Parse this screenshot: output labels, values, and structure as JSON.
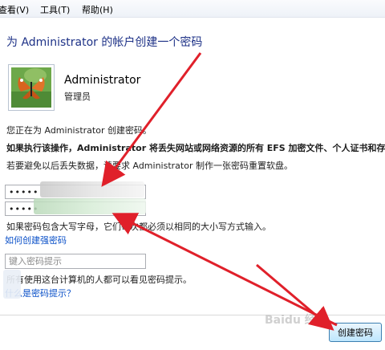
{
  "menu": {
    "view": "查看(V)",
    "tools": "工具(T)",
    "help": "帮助(H)"
  },
  "title": "为 Administrator 的帐户创建一个密码",
  "user": {
    "name": "Administrator",
    "role": "管理员"
  },
  "text": {
    "creating": "您正在为 Administrator 创建密码。",
    "warning": "如果执行该操作，Administrator 将丢失网站或网络资源的所有 EFS 加密文件、个人证书和存",
    "avoid": "若要避免以后丢失数据，请要求 Administrator 制作一张密码重置软盘。",
    "case_note": "如果密码包含大写字母，它们每次都必须以相同的大小写方式输入。",
    "hint_visible": "所有使用这台计算机的人都可以看见密码提示。"
  },
  "password": {
    "value": "•••••",
    "confirm_value": "•••••"
  },
  "links": {
    "strong_password": "如何创建强密码",
    "what_is_hint": "什么是密码提示？"
  },
  "hint": {
    "placeholder": "键入密码提示"
  },
  "buttons": {
    "create": "创建密码"
  },
  "watermark": "Baidu 经验",
  "colors": {
    "title": "#1e3287",
    "link": "#0a50c8",
    "arrow": "#e0202a"
  }
}
